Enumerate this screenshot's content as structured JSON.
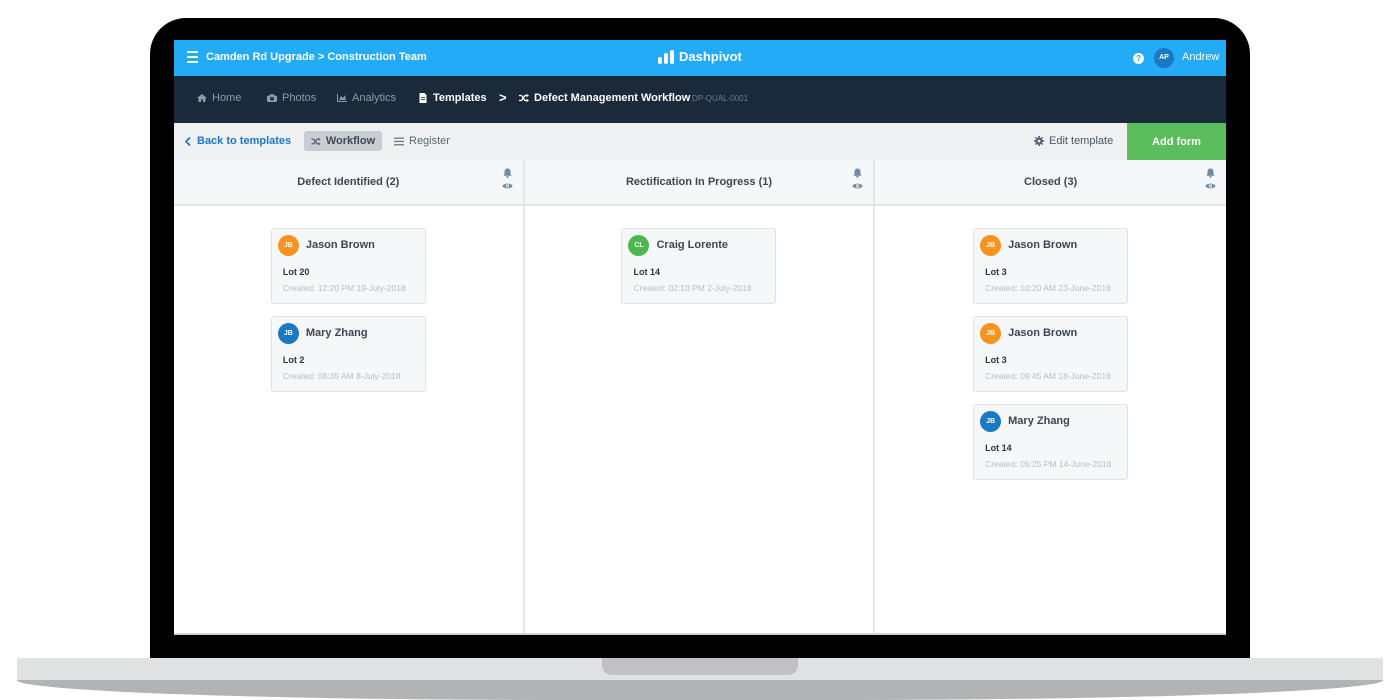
{
  "topbar": {
    "project_path": "Camden Rd Upgrade > Construction Team",
    "brand": "Dashpivot",
    "help_icon": "?",
    "user_initials": "AP",
    "user_name": "Andrew",
    "colors": {
      "topbar_bg": "#24abf8",
      "avatar_bg": "#1b78c2"
    }
  },
  "nav": {
    "items": [
      {
        "label": "Home",
        "icon": "home-icon"
      },
      {
        "label": "Photos",
        "icon": "camera-icon"
      },
      {
        "label": "Analytics",
        "icon": "chart-icon"
      },
      {
        "label": "Templates",
        "icon": "document-icon",
        "active": true
      }
    ],
    "separator": ">",
    "workflow_title": "Defect Management Workflow",
    "workflow_code": "DP-QUAL-0001"
  },
  "toolbar": {
    "back_label": "Back to templates",
    "workflow_label": "Workflow",
    "register_label": "Register",
    "edit_template_label": "Edit template",
    "add_form_label": "Add form",
    "colors": {
      "add_form_bg": "#5cbd5c",
      "link": "#1d79c8"
    }
  },
  "columns": [
    {
      "title": "Defect Identified (2)",
      "cards": [
        {
          "initials": "JB",
          "name": "Jason Brown",
          "avatar_color": "#f7931e",
          "lot": "Lot 20",
          "created": "Created: 12:20 PM 19-July-2018"
        },
        {
          "initials": "JB",
          "name": "Mary Zhang",
          "avatar_color": "#1b78c2",
          "lot": "Lot 2",
          "created": "Created: 08:35 AM 8-July-2018"
        }
      ]
    },
    {
      "title": "Rectification In Progress (1)",
      "cards": [
        {
          "initials": "CL",
          "name": "Craig Lorente",
          "avatar_color": "#4cb84c",
          "lot": "Lot 14",
          "created": "Created: 02:10 PM 2-July-2018"
        }
      ]
    },
    {
      "title": "Closed (3)",
      "cards": [
        {
          "initials": "JB",
          "name": "Jason Brown",
          "avatar_color": "#f7931e",
          "lot": "Lot 3",
          "created": "Created: 10:20 AM 23-June-2018"
        },
        {
          "initials": "JB",
          "name": "Jason Brown",
          "avatar_color": "#f7931e",
          "lot": "Lot 3",
          "created": "Created: 09:45 AM 18-June-2018"
        },
        {
          "initials": "JB",
          "name": "Mary Zhang",
          "avatar_color": "#1b78c2",
          "lot": "Lot 14",
          "created": "Created: 05:25 PM 14-June-2018"
        }
      ]
    }
  ]
}
